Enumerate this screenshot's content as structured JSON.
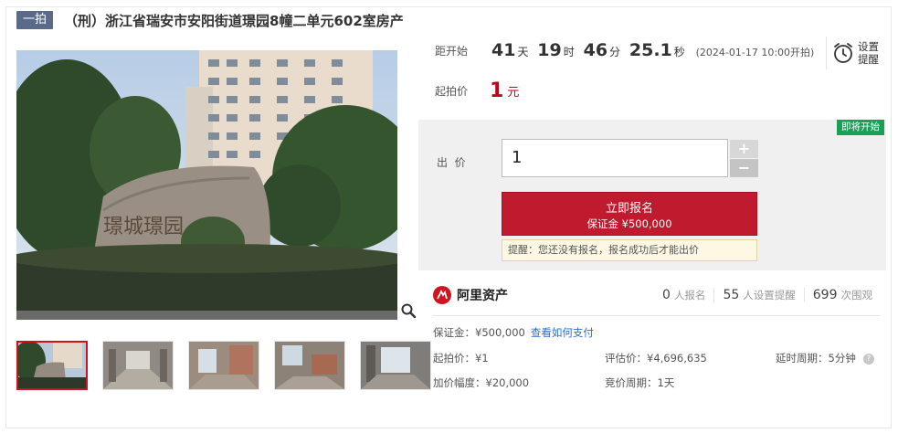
{
  "header": {
    "round_badge": "一拍",
    "title": "（刑）浙江省瑞安市安阳街道璟园8幢二单元602室房产"
  },
  "countdown": {
    "label": "距开始",
    "days": "41",
    "days_unit": "天",
    "hours": "19",
    "hours_unit": "时",
    "minutes": "46",
    "minutes_unit": "分",
    "seconds": "25.1",
    "seconds_unit": "秒",
    "start_text": "(2024-01-17 10:00开拍)"
  },
  "reminder": {
    "line1": "设置",
    "line2": "提醒",
    "icon": "alarm-clock-icon"
  },
  "start_price": {
    "label": "起拍价",
    "value": "1",
    "unit": "元"
  },
  "bid": {
    "status_badge": "即将开始",
    "label": "出  价",
    "input_value": "1",
    "plus": "+",
    "minus": "−",
    "signup_label": "立即报名",
    "signup_deposit": "保证金 ¥500,000",
    "tip": "提醒：您还没有报名，报名成功后才能出价"
  },
  "stats": {
    "brand": "阿里资产",
    "signups_count": "0",
    "signups_label": "人报名",
    "reminders_count": "55",
    "reminders_label": "人设置提醒",
    "views_count": "699",
    "views_label": "次围观"
  },
  "details": {
    "deposit": "保证金：¥500,000",
    "how_to_pay": "查看如何支付",
    "start_price": "起拍价：¥1",
    "increment": "加价幅度：¥20,000",
    "appraisal": "评估价：¥4,696,635",
    "cycle": "竞价周期：1天",
    "delay": "延时周期：5分钟",
    "help_glyph": "?"
  },
  "gallery": {
    "main_photo_text": "璟城璟园",
    "zoom_icon": "magnifier-icon",
    "thumbnail_count": 5
  },
  "colors": {
    "accent_red": "#c40018",
    "button_red": "#bf1a2d",
    "status_green": "#18a058",
    "badge_slate": "#5a6a88",
    "link_blue": "#2b6fd6"
  }
}
